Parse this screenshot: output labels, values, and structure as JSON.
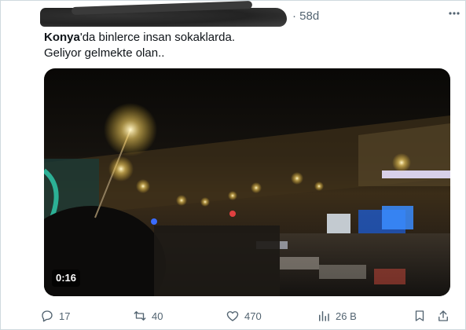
{
  "post": {
    "time": "· 58d",
    "hashtag": "Konya",
    "text_rest": "'da binlerce insan sokaklarda.",
    "line2": "Geliyor gelmekte olan..",
    "video": {
      "duration": "0:16"
    },
    "stats": {
      "replies": "17",
      "reposts": "40",
      "likes": "470",
      "views": "26 B"
    }
  },
  "colors": {
    "muted": "#536471",
    "text": "#0f1419",
    "border": "#cfd9de"
  },
  "icons": [
    "more-icon",
    "reply-icon",
    "repost-icon",
    "like-icon",
    "views-icon",
    "bookmark-icon",
    "share-icon"
  ]
}
